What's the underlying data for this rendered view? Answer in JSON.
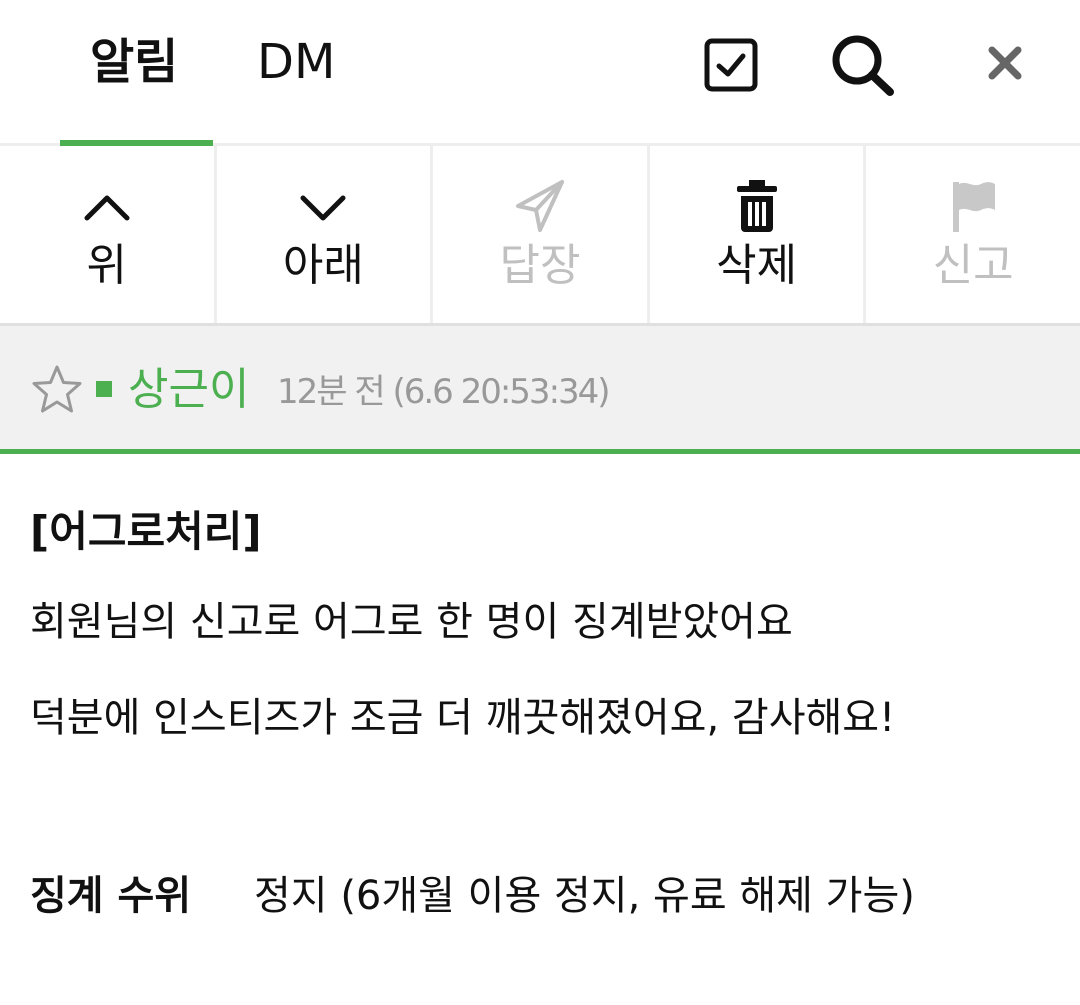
{
  "tabs": {
    "notice": "알림",
    "dm": "DM"
  },
  "header_icons": {
    "select": "checkbox-icon",
    "search": "search-icon",
    "close": "close-icon"
  },
  "toolbar": [
    {
      "label": "위",
      "icon": "chevron-up-icon",
      "enabled": true
    },
    {
      "label": "아래",
      "icon": "chevron-down-icon",
      "enabled": true
    },
    {
      "label": "답장",
      "icon": "send-icon",
      "enabled": false
    },
    {
      "label": "삭제",
      "icon": "trash-icon",
      "enabled": true
    },
    {
      "label": "신고",
      "icon": "flag-icon",
      "enabled": false
    }
  ],
  "message": {
    "author": "상근이",
    "time": "12분 전 (6.6 20:53:34)",
    "title": "[어그로처리]",
    "line1": "회원님의 신고로 어그로 한 명이 징계받았어요",
    "line2": "덕분에 인스티즈가 조금 더 깨끗해졌어요, 감사해요!",
    "penalty_label": "징계 수위",
    "penalty_value": "정지 (6개월 이용 정지, 유료 해제 가능)"
  },
  "colors": {
    "accent": "#4caf50",
    "disabled": "#c0c0c0",
    "meta_bg": "#f1f1f1"
  }
}
